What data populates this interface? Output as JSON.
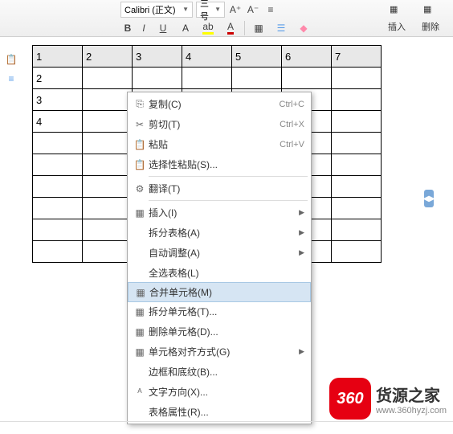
{
  "toolbar": {
    "font_name": "Calibri (正文)",
    "font_size": "三号",
    "increase_font": "A⁺",
    "decrease_font": "A⁻",
    "bold": "B",
    "italic": "I",
    "underline": "U",
    "strike": "A",
    "insert_label": "插入",
    "delete_label": "删除"
  },
  "headers": [
    "1",
    "2",
    "3",
    "4",
    "5",
    "6",
    "7"
  ],
  "col0": [
    "2",
    "3",
    "4"
  ],
  "menu": {
    "items": [
      {
        "icon": "copy",
        "label": "复制(C)",
        "shortcut": "Ctrl+C"
      },
      {
        "icon": "cut",
        "label": "剪切(T)",
        "shortcut": "Ctrl+X"
      },
      {
        "icon": "paste",
        "label": "粘贴",
        "shortcut": "Ctrl+V"
      },
      {
        "icon": "paste-special",
        "label": "选择性粘贴(S)..."
      },
      {
        "sep": true
      },
      {
        "icon": "translate",
        "label": "翻译(T)"
      },
      {
        "sep": true
      },
      {
        "icon": "insert",
        "label": "插入(I)",
        "submenu": true
      },
      {
        "icon": "",
        "label": "拆分表格(A)",
        "submenu": true
      },
      {
        "icon": "",
        "label": "自动调整(A)",
        "submenu": true
      },
      {
        "icon": "",
        "label": "全选表格(L)"
      },
      {
        "icon": "merge",
        "label": "合并单元格(M)",
        "highlight": true
      },
      {
        "icon": "split",
        "label": "拆分单元格(T)..."
      },
      {
        "icon": "delete-cell",
        "label": "删除单元格(D)..."
      },
      {
        "icon": "align",
        "label": "单元格对齐方式(G)",
        "submenu": true
      },
      {
        "icon": "",
        "label": "边框和底纹(B)..."
      },
      {
        "icon": "text-dir",
        "label": "文字方向(X)..."
      },
      {
        "icon": "",
        "label": "表格属性(R)..."
      }
    ]
  },
  "watermark": {
    "badge": "360",
    "title": "货源之家",
    "url": "www.360hyzj.com"
  }
}
